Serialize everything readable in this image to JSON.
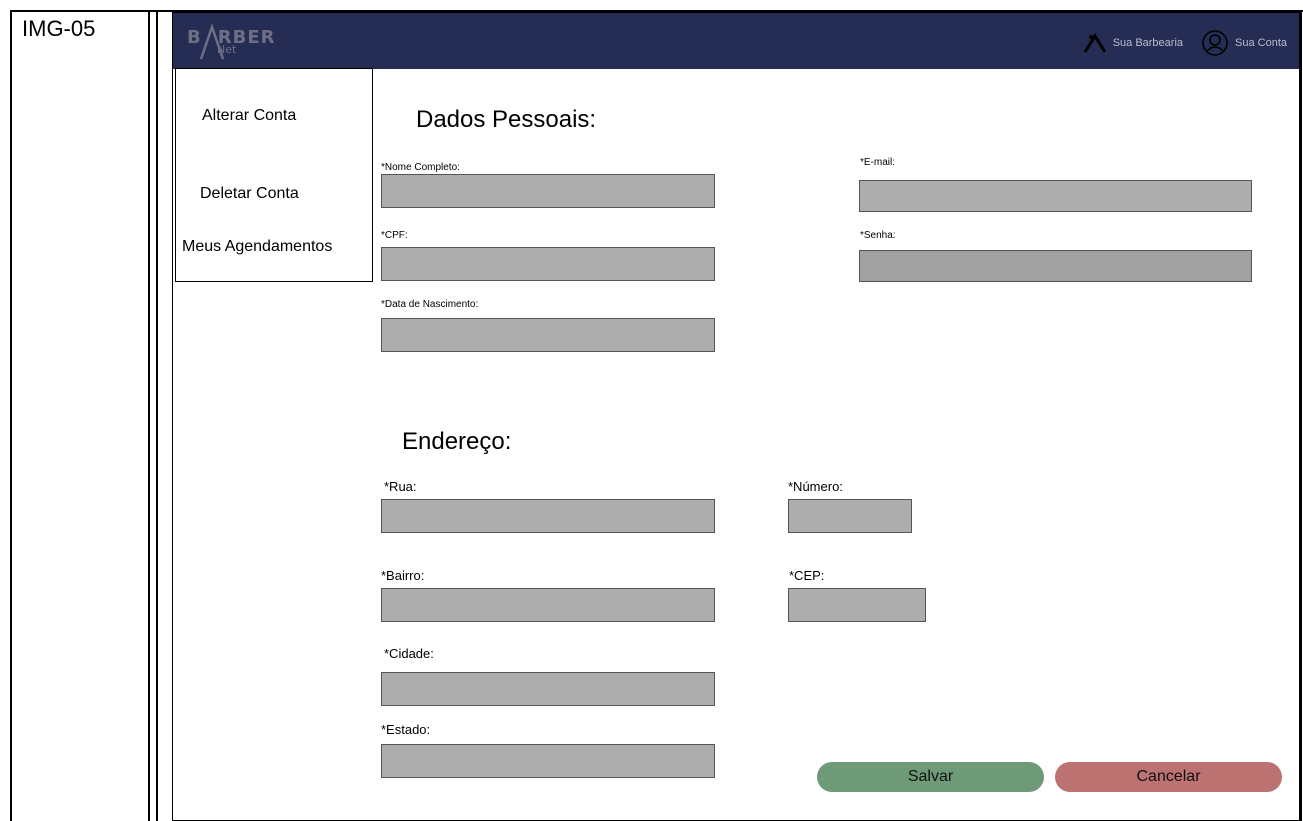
{
  "doc": {
    "label": "IMG-05"
  },
  "header": {
    "logo_text": "B",
    "logo_text2": "RBER",
    "logo_sub": "Net",
    "barbearia_label": "Sua Barbearia",
    "conta_label": "Sua Conta"
  },
  "sidebar": {
    "items": [
      {
        "label": "Alterar Conta"
      },
      {
        "label": "Deletar Conta"
      },
      {
        "label": "Meus Agendamentos"
      }
    ]
  },
  "personal": {
    "title": "Dados Pessoais:",
    "nome_label": "*Nome Completo:",
    "email_label": "*E-mail:",
    "cpf_label": "*CPF:",
    "senha_label": "*Senha:",
    "nascimento_label": "*Data de Nascimento:"
  },
  "address": {
    "title": "Endereço:",
    "rua_label": "*Rua:",
    "numero_label": "*Número:",
    "bairro_label": "*Bairro:",
    "cep_label": "*CEP:",
    "cidade_label": "*Cidade:",
    "estado_label": "*Estado:"
  },
  "actions": {
    "save_label": "Salvar",
    "cancel_label": "Cancelar"
  },
  "colors": {
    "header": "#252d54",
    "field": "#adadad",
    "save": "#6e9a77",
    "cancel": "#bd7272"
  }
}
